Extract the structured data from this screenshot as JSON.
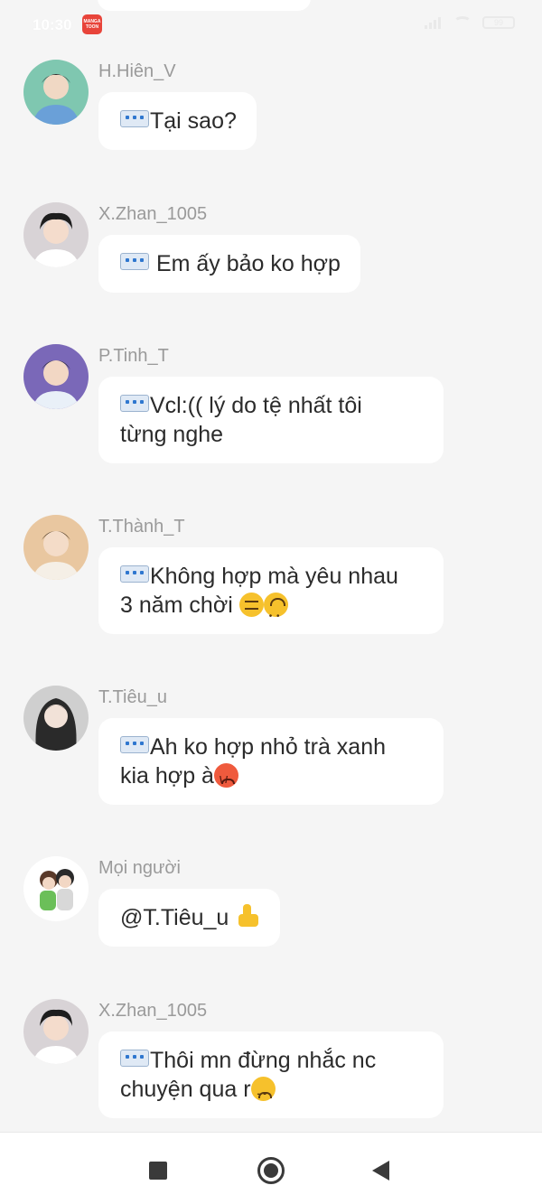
{
  "status_bar": {
    "time": "10:30",
    "app_badge": "MANGA TOON",
    "battery": "99"
  },
  "messages": [
    {
      "sender": "H.Hiên_V",
      "text": "Tại sao?",
      "lead_icon": "chat-bubble-icon",
      "emojis": [],
      "avatar_colors": [
        "#7fc7b0",
        "#2c2c2c",
        "#f0d8c4",
        "#6aa0d8"
      ]
    },
    {
      "sender": "X.Zhan_1005",
      "text": "Em ấy bảo ko hợp",
      "lead_icon": "chat-bubble-icon",
      "emojis": [],
      "avatar_colors": [
        "#d8d3d6",
        "#1d1d1d",
        "#f4dccc",
        "#ffffff"
      ]
    },
    {
      "sender": "P.Tinh_T",
      "text_lines": [
        "Vcl:(( lý do tệ nhất tôi",
        "từng nghe"
      ],
      "lead_icon": "chat-bubble-icon",
      "emojis": [],
      "avatar_colors": [
        "#7a68b8",
        "#222222",
        "#f2d7c4",
        "#e9f0f8"
      ]
    },
    {
      "sender": "T.Thành_T",
      "text_lines": [
        "Không hợp mà yêu nhau",
        "3 năm chời "
      ],
      "lead_icon": "chat-bubble-icon",
      "emojis": [
        "expressionless-face-icon",
        "upside-down-face-icon"
      ],
      "avatar_colors": [
        "#e9c7a0",
        "#3a2a1d",
        "#f4dcc8",
        "#f5efe6"
      ]
    },
    {
      "sender": "T.Tiêu_u",
      "text_lines": [
        "Ah ko hợp nhỏ trà xanh",
        "kia hợp à"
      ],
      "lead_icon": "chat-bubble-icon",
      "emojis": [
        "angry-face-icon"
      ],
      "avatar_colors": [
        "#cfcfcf",
        "#2a2a2a",
        "#f2e2d8",
        "#ececec"
      ]
    },
    {
      "sender": "Mọi người",
      "text": "@T.Tiêu_u ",
      "lead_icon": "",
      "emojis": [
        "thumbs-up-icon"
      ],
      "avatar_colors": [
        "#ffffff",
        "#6bbf59",
        "#5a3a2a",
        "#d8d8d8"
      ]
    },
    {
      "sender": "X.Zhan_1005",
      "text_lines": [
        "Thôi mn đừng nhắc nc",
        "chuyện qua r"
      ],
      "lead_icon": "chat-bubble-icon",
      "emojis": [
        "disappointed-face-icon"
      ],
      "avatar_colors": [
        "#d8d3d6",
        "#1d1d1d",
        "#f4dccc",
        "#ffffff"
      ]
    }
  ],
  "nav_bar": {
    "recent_icon": "square-recent-apps-icon",
    "home_icon": "circle-home-icon",
    "back_icon": "triangle-back-icon"
  },
  "colors": {
    "background": "#f5f5f5",
    "bubble": "#ffffff",
    "sender_text": "#9a9a9a",
    "message_text": "#2b2b2b"
  }
}
